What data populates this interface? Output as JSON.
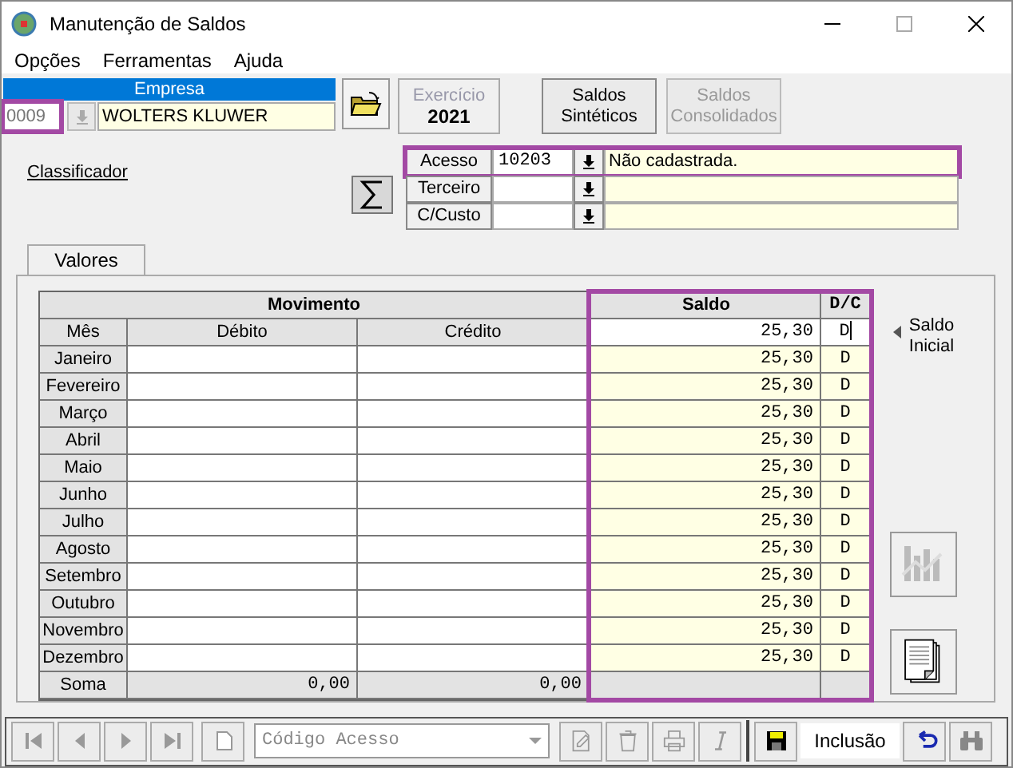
{
  "window": {
    "title": "Manutenção de Saldos"
  },
  "menu": [
    "Opções",
    "Ferramentas",
    "Ajuda"
  ],
  "empresa": {
    "label": "Empresa",
    "code": "0009",
    "name": "WOLTERS KLUWER",
    "highlighted": true
  },
  "exercicio": {
    "label": "Exercício",
    "value": "2021"
  },
  "buttons": [
    {
      "line1": "Saldos",
      "line2": "Sintéticos",
      "disabled": false
    },
    {
      "line1": "Saldos",
      "line2": "Consolidados",
      "disabled": true
    }
  ],
  "classificador": "Classificador",
  "filters": [
    {
      "label": "Acesso",
      "code": "10203",
      "description": "Não cadastrada.",
      "highlighted": true
    },
    {
      "label": "Terceiro",
      "highlighted": false
    },
    {
      "label": "C/Custo",
      "highlighted": false
    }
  ],
  "tabs": [
    {
      "label": "Valores",
      "selected": true
    }
  ],
  "grid": {
    "group_header": "Movimento",
    "saldo_header": "Saldo",
    "dc_header": "D/C",
    "columns": [
      "Mês",
      "Débito",
      "Crédito"
    ],
    "initial_saldo": "25,30",
    "initial_dc": "D",
    "saldo_highlighted": true,
    "rows": [
      {
        "month": "Janeiro",
        "saldo": "25,30",
        "dc": "D"
      },
      {
        "month": "Fevereiro",
        "saldo": "25,30",
        "dc": "D"
      },
      {
        "month": "Março",
        "saldo": "25,30",
        "dc": "D"
      },
      {
        "month": "Abril",
        "saldo": "25,30",
        "dc": "D"
      },
      {
        "month": "Maio",
        "saldo": "25,30",
        "dc": "D"
      },
      {
        "month": "Junho",
        "saldo": "25,30",
        "dc": "D"
      },
      {
        "month": "Julho",
        "saldo": "25,30",
        "dc": "D"
      },
      {
        "month": "Agosto",
        "saldo": "25,30",
        "dc": "D"
      },
      {
        "month": "Setembro",
        "saldo": "25,30",
        "dc": "D"
      },
      {
        "month": "Outubro",
        "saldo": "25,30",
        "dc": "D"
      },
      {
        "month": "Novembro",
        "saldo": "25,30",
        "dc": "D"
      },
      {
        "month": "Dezembro",
        "saldo": "25,30",
        "dc": "D"
      }
    ],
    "totals": {
      "label": "Soma",
      "debito": "0,00",
      "credito": "0,00"
    }
  },
  "saldo_inicial": {
    "line1": "Saldo",
    "line2": "Inicial"
  },
  "side_buttons": [
    {
      "kind": "chart",
      "disabled": true
    },
    {
      "kind": "report",
      "disabled": false
    }
  ],
  "toolbar": {
    "nav": [
      {
        "kind": "first",
        "disabled": true
      },
      {
        "kind": "prev",
        "disabled": true
      },
      {
        "kind": "next",
        "disabled": true
      },
      {
        "kind": "last",
        "disabled": true
      },
      {
        "kind": "new",
        "disabled": true
      }
    ],
    "combo": {
      "value": "Código Acesso",
      "disabled": true
    },
    "actions": [
      {
        "kind": "edit",
        "disabled": true
      },
      {
        "kind": "delete",
        "disabled": true
      },
      {
        "kind": "print",
        "disabled": true
      },
      {
        "kind": "italic",
        "disabled": true
      }
    ],
    "save": {
      "disabled": false
    },
    "mode": "Inclusão",
    "tail": [
      {
        "kind": "undo",
        "disabled": false
      },
      {
        "kind": "find",
        "disabled": true
      }
    ]
  }
}
